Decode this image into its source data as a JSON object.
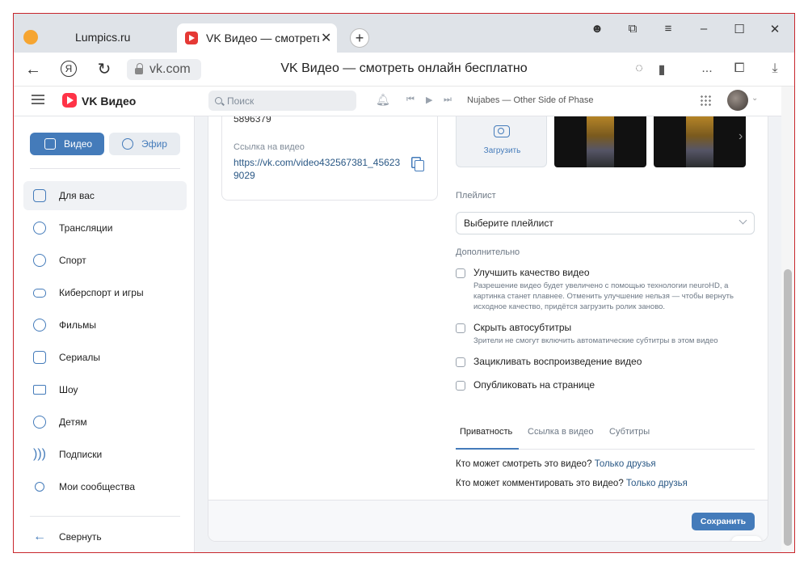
{
  "browser": {
    "tabs": [
      {
        "title": "Lumpics.ru"
      },
      {
        "title": "VK Видео — смотреть о"
      }
    ],
    "tab_close": "✕",
    "new_tab": "+",
    "domain": "vk.com",
    "page_title": "VK Видео — смотреть онлайн бесплатно",
    "ya_letter": "Я",
    "more": "..."
  },
  "header": {
    "brand": "VK Видео",
    "search_placeholder": "Поиск",
    "now_playing": "Nujabes — Other Side of Phase"
  },
  "sidebar": {
    "btn_video": "Видео",
    "btn_live": "Эфир",
    "items": [
      {
        "label": "Для вас",
        "icon": "thumbs-up-icon"
      },
      {
        "label": "Трансляции",
        "icon": "broadcast-icon"
      },
      {
        "label": "Спорт",
        "icon": "ball-icon"
      },
      {
        "label": "Киберспорт и игры",
        "icon": "gamepad-icon"
      },
      {
        "label": "Фильмы",
        "icon": "film-reel-icon"
      },
      {
        "label": "Сериалы",
        "icon": "series-icon"
      },
      {
        "label": "Шоу",
        "icon": "tv-icon"
      },
      {
        "label": "Детям",
        "icon": "kids-icon"
      },
      {
        "label": "Подписки",
        "icon": "subscriptions-icon"
      },
      {
        "label": "Мои сообщества",
        "icon": "communities-icon"
      }
    ],
    "collapse": "Свернуть"
  },
  "editor": {
    "video_id_tail": "5896379",
    "link_label": "Ссылка на видео",
    "link_value": "https://vk.com/video432567381_456239029",
    "upload_label": "Загрузить",
    "playlist_label": "Плейлист",
    "playlist_select": "Выберите плейлист",
    "extra_label": "Дополнительно",
    "options": [
      {
        "title": "Улучшить качество видео",
        "desc": "Разрешение видео будет увеличено с помощью технологии neuroHD, а картинка станет плавнее. Отменить улучшение нельзя — чтобы вернуть исходное качество, придётся загрузить ролик заново.",
        "checked": false
      },
      {
        "title": "Скрыть автосубтитры",
        "desc": "Зрители не смогут включить автоматические субтитры в этом видео",
        "checked": false
      },
      {
        "title": "Зацикливать воспроизведение видео",
        "desc": "",
        "checked": false
      },
      {
        "title": "Опубликовать на странице",
        "desc": "",
        "checked": false
      }
    ],
    "tabs": [
      "Приватность",
      "Ссылка в видео",
      "Субтитры"
    ],
    "privacy_view_q": "Кто может смотреть это видео?",
    "privacy_view_a": "Только друзья",
    "privacy_comment_q": "Кто может комментировать это видео?",
    "privacy_comment_a": "Только друзья",
    "save": "Сохранить"
  },
  "colors": {
    "accent": "#447bba",
    "vk_red": "#ff3347",
    "link": "#2a5885"
  }
}
